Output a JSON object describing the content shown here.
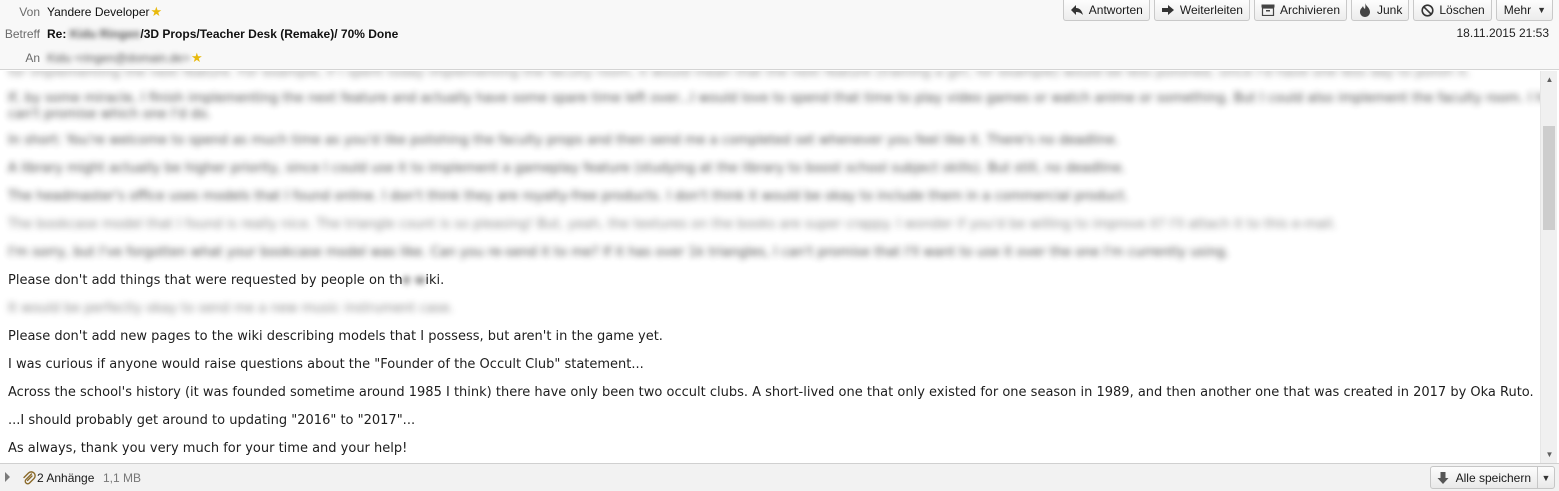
{
  "header": {
    "from_label": "Von",
    "from_value": "Yandere Developer",
    "subject_label": "Betreff",
    "subject_prefix": "Re:",
    "subject_redacted": "Kidu Ringen",
    "subject_rest": "/3D Props/Teacher Desk (Remake)/ 70% Done",
    "to_label": "An",
    "to_redacted": "Kidu <ringen@domain.de>",
    "date": "18.11.2015 21:53"
  },
  "toolbar": {
    "reply": "Antworten",
    "forward": "Weiterleiten",
    "archive": "Archivieren",
    "junk": "Junk",
    "delete": "Löschen",
    "more": "Mehr"
  },
  "body": {
    "blurred": [
      "for implementing the next feature. For example, if I spent today implementing the faculty room, it would mean that the next feature (training a girl, for example) would be less polished, since I'd have one less day to polish it.",
      "If, by some miracle, I finish implementing the next feature and actually have some spare time left over...I would love to spend that time to play video games or watch anime or something. But I could also implement the faculty room. I honestly",
      "can't promise which one I'd do.",
      "In short: You're welcome to spend as much time as you'd like polishing the faculty props and then send me a completed set whenever you feel like it. There's no deadline.",
      "A library might actually be higher priority, since I could use it to implement a gameplay feature (studying at the library to boost school subject skills). But still, no deadline.",
      "The headmaster's office uses models that I found online. I don't think they are royalty-free products. I don't think it would be okay to include them in a commercial product.",
      "The bookcase model that I found is really nice. The triangle count is so pleasing! But, yeah, the textures on the books are super crappy. I wonder if you'd be willing to improve it? I'll attach it to this e-mail.",
      "I'm sorry, but I've forgotten what your bookcase model was like. Can you re-send it to me? If it has over 1k triangles, I can't promise that I'll want to use it over the one I'm currently using."
    ],
    "wiki_prefix": "Please don't add things that were requested by people on th",
    "wiki_blur": "e w",
    "wiki_suffix": "iki.",
    "music_blurred": "It would be perfectly okay to send me a new music instrument case.",
    "lines": [
      "Please don't add new pages to the wiki describing models that I possess, but aren't in the game yet.",
      "I was curious if anyone would raise questions about the \"Founder of the Occult Club\" statement...",
      "Across the school's history (it was founded sometime around 1985 I think) there have only been two occult clubs. A short-lived one that only existed for one season in 1989, and then another one that was created in 2017 by Oka Ruto.",
      "...I should probably get around to updating \"2016\" to \"2017\"...",
      "As always, thank you very much for your time and your help!"
    ]
  },
  "footer": {
    "attachments": "2 Anhänge",
    "size": "1,1 MB",
    "save_all": "Alle speichern"
  }
}
